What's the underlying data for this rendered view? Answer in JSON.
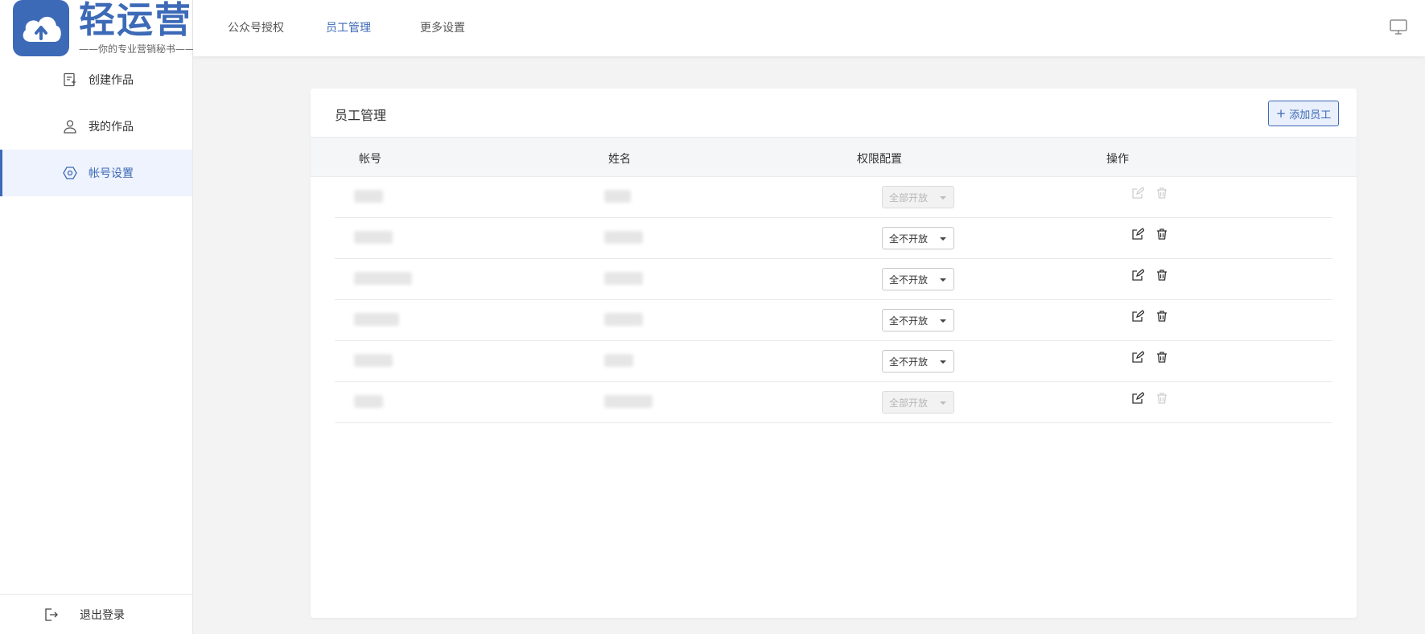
{
  "logo": {
    "name": "轻运营",
    "slogan": "——你的专业营销秘书——",
    "icon": "cloud-upload-icon"
  },
  "sidebar": {
    "items": [
      {
        "label": "创建作品",
        "icon": "create-doc-icon",
        "active": false
      },
      {
        "label": "我的作品",
        "icon": "user-icon",
        "active": false
      },
      {
        "label": "帐号设置",
        "icon": "settings-hex-icon",
        "active": true
      }
    ],
    "logout": {
      "label": "退出登录",
      "icon": "logout-icon"
    }
  },
  "topbar": {
    "tabs": [
      {
        "label": "公众号授权",
        "active": false
      },
      {
        "label": "员工管理",
        "active": true
      },
      {
        "label": "更多设置",
        "active": false
      }
    ],
    "right_icon": "monitor-icon"
  },
  "card": {
    "title": "员工管理",
    "add_button": "添加员工",
    "columns": [
      "帐号",
      "姓名",
      "权限配置",
      "操作"
    ],
    "rows": [
      {
        "permission": "全部开放",
        "permission_disabled": true,
        "edit_enabled": false,
        "delete_enabled": false
      },
      {
        "permission": "全不开放",
        "permission_disabled": false,
        "edit_enabled": true,
        "delete_enabled": true
      },
      {
        "permission": "全不开放",
        "permission_disabled": false,
        "edit_enabled": true,
        "delete_enabled": true
      },
      {
        "permission": "全不开放",
        "permission_disabled": false,
        "edit_enabled": true,
        "delete_enabled": true
      },
      {
        "permission": "全不开放",
        "permission_disabled": false,
        "edit_enabled": true,
        "delete_enabled": true
      },
      {
        "permission": "全部开放",
        "permission_disabled": true,
        "edit_enabled": true,
        "delete_enabled": false
      }
    ]
  },
  "colors": {
    "accent": "#3d6ab7",
    "active_bg": "#eef3fd",
    "page_bg": "#f3f3f3"
  }
}
